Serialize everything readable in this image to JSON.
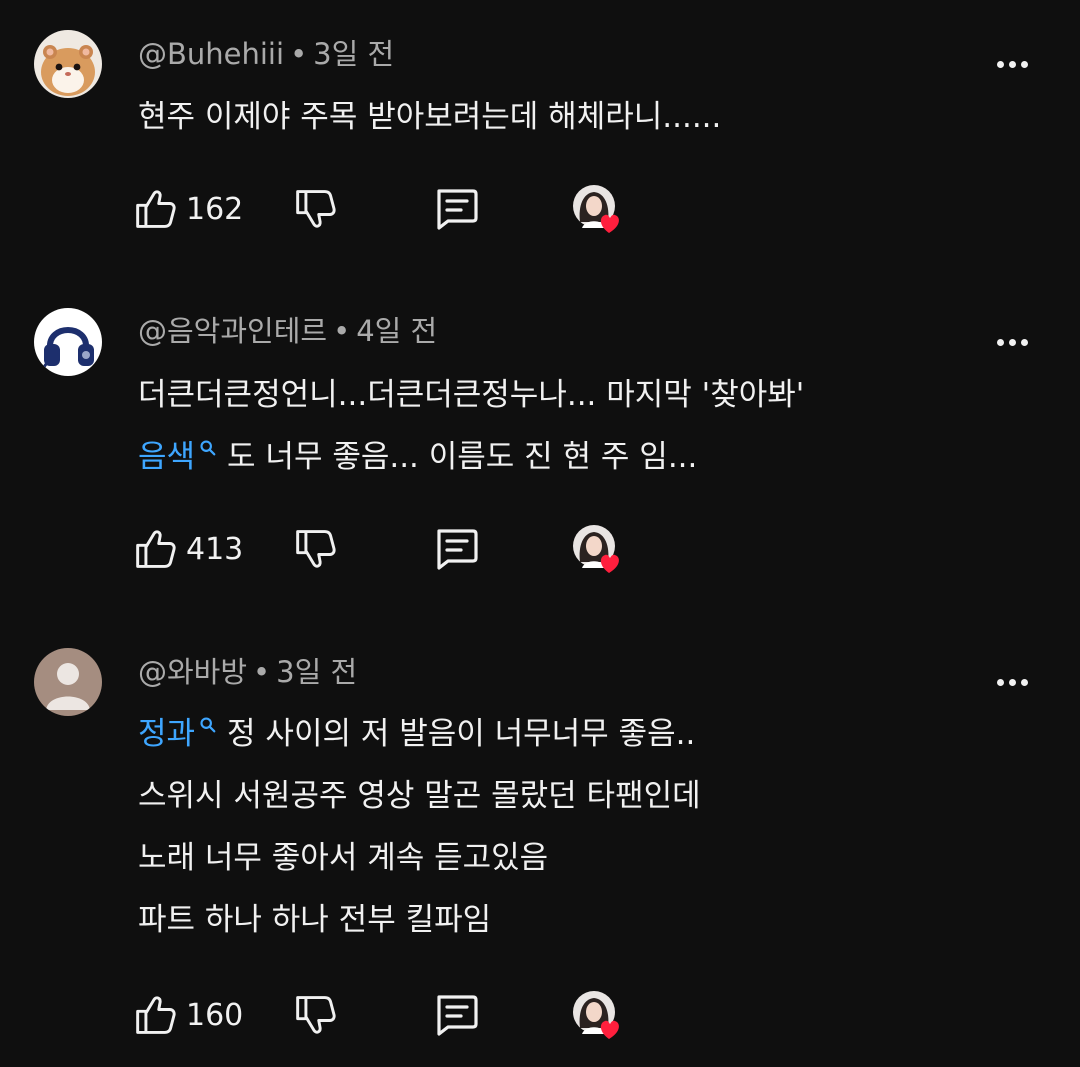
{
  "comments": [
    {
      "author": "@Buhehiii",
      "time": "3일 전",
      "avatar": "hamster-avatar",
      "lines": [
        "현주 이제야 주목 받아보려는데 해체라니......"
      ],
      "likes": "162"
    },
    {
      "author": "@음악과인테르",
      "time": "4일 전",
      "avatar": "headphones-avatar",
      "line1": "더큰더큰정언니...더큰더큰정누나... 마지막 '찾아봐'",
      "tag": "음색",
      "line2_rest": "도 너무 좋음... 이름도 진 현 주 임...",
      "likes": "413"
    },
    {
      "author": "@와바방",
      "time": "3일 전",
      "avatar": "default-avatar",
      "tag": "정과",
      "line1_rest": "정 사이의 저 발음이 너무너무 좋음..",
      "lines": [
        "스위시 서원공주 영상 말곤 몰랐던 타팬인데",
        "노래 너무 좋아서 계속 듣고있음",
        "파트 하나 하나 전부 킬파임"
      ],
      "likes": "160"
    }
  ],
  "meta_separator": "•",
  "colors": {
    "background": "#0f0f0f",
    "text": "#f1f1f1",
    "secondary": "#aaaaaa",
    "link": "#3ea6ff",
    "heart": "#ff1f3d"
  }
}
